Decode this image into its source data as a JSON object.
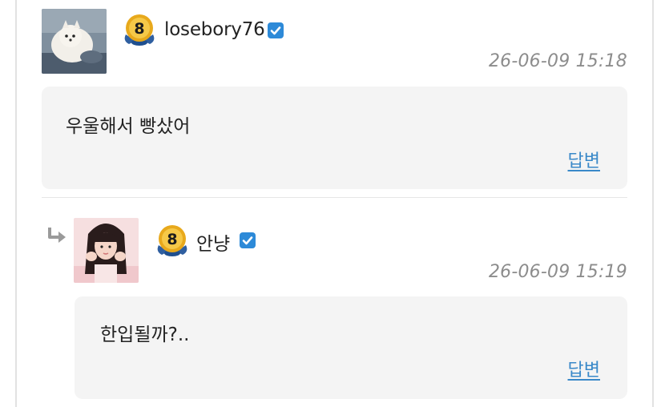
{
  "comments": [
    {
      "username": "losebory76",
      "level": "8",
      "timestamp": "26-06-09 15:18",
      "text": "우울해서 빵샀어",
      "reply_label": "답변",
      "avatar_icon": "dog-photo-avatar",
      "badge_icon": "level-medal-icon",
      "verified_icon": "verified-check-icon"
    },
    {
      "username": "안냥",
      "level": "8",
      "timestamp": "26-06-09 15:19",
      "text": "한입될까?..",
      "reply_label": "답변",
      "avatar_icon": "girl-photo-avatar",
      "badge_icon": "level-medal-icon",
      "verified_icon": "verified-check-icon",
      "is_reply": true
    }
  ],
  "colors": {
    "bubble_bg": "#f4f4f4",
    "link": "#3a89c9",
    "verified": "#2d8ad8",
    "timestamp": "#8c8c8c",
    "medal_gold": "#e8a91c"
  }
}
